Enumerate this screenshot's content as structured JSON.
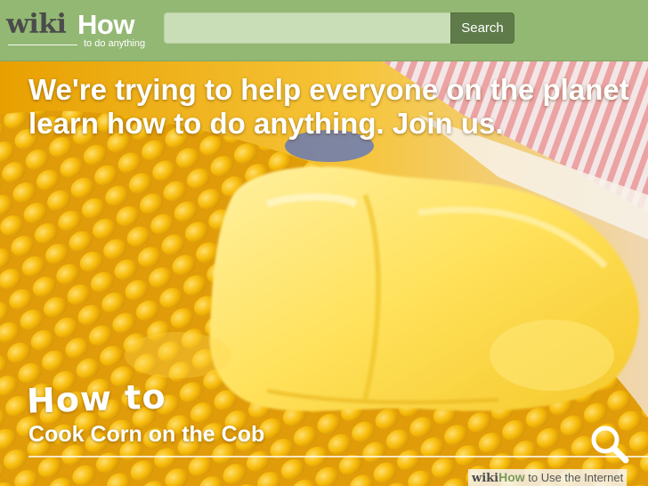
{
  "header": {
    "logo": {
      "wiki": "wiki",
      "how": "How",
      "tagline": "to do anything"
    },
    "search": {
      "value": "",
      "placeholder": "",
      "button_label": "Search"
    }
  },
  "hero": {
    "headline": "We're trying to help everyone on the planet\nlearn how to do anything. Join us.",
    "howto": "How to",
    "topic": "Cook Corn on the Cob",
    "search_icon": "magnifier-icon"
  },
  "watermark": {
    "wiki": "wiki",
    "how": "How",
    "text": " to Use the Internet"
  },
  "colors": {
    "header_green": "#93b874",
    "search_field": "#c9deb6",
    "search_button": "#5f7b49",
    "corn_yellow": "#f2b600",
    "butter": "#ffe35a"
  }
}
